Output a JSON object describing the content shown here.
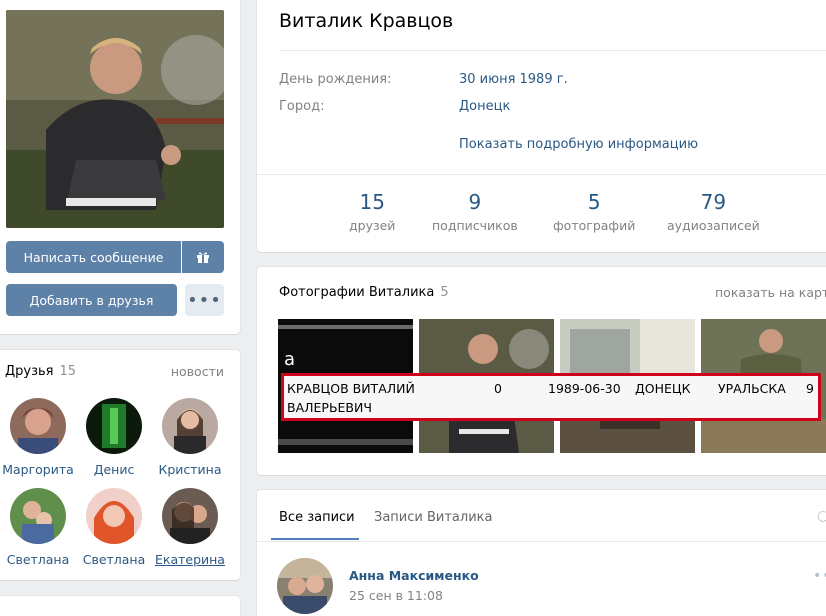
{
  "profile": {
    "name": "Виталик Кравцов",
    "birthday_label": "День рождения:",
    "birthday_value": "30 июня 1989 г.",
    "city_label": "Город:",
    "city_value": "Донецк",
    "more_info": "Показать подробную информацию"
  },
  "stats": [
    {
      "count": "15",
      "label": "друзей"
    },
    {
      "count": "9",
      "label": "подписчиков"
    },
    {
      "count": "5",
      "label": "фотографий"
    },
    {
      "count": "79",
      "label": "аудиозаписей"
    }
  ],
  "actions": {
    "message": "Написать сообщение",
    "add_friend": "Добавить в друзья",
    "more": "•••"
  },
  "friends": {
    "title": "Друзья",
    "count": "15",
    "news": "новости",
    "list": [
      {
        "name": "Маргорита"
      },
      {
        "name": "Денис"
      },
      {
        "name": "Кристина"
      },
      {
        "name": "Светлана"
      },
      {
        "name": "Светлана"
      },
      {
        "name": "Екатерина"
      }
    ]
  },
  "photos": {
    "title": "Фотографии Виталика",
    "count": "5",
    "map_link": "показать на карте",
    "overlay_text": "a"
  },
  "record": {
    "name_line1": "КРАВЦОВ ВИТАЛИЙ",
    "name_line2": "ВАЛЕРЬЕВИЧ",
    "field_zero": "0",
    "date": "1989-06-30",
    "city": "ДОНЕЦК",
    "street": "УРАЛЬСКА",
    "house": "9"
  },
  "wall": {
    "tab_all": "Все записи",
    "tab_own": "Записи Виталика",
    "post_author": "Анна Максименко",
    "post_date": "25 сен в 11:08"
  },
  "colors": {
    "link": "#2a5885",
    "button": "#5e81a8",
    "highlight_border": "#d0021b"
  }
}
